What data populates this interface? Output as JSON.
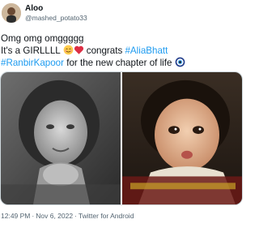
{
  "author": {
    "name": "Aloo",
    "handle": "@mashed_potato33"
  },
  "tweet": {
    "line1": "Omg omg omggggg",
    "line2_start": "It's a GIRLLLL",
    "line2_mid": " congrats ",
    "hashtag1": "#AliaBhatt",
    "hashtag2": "#RanbirKapoor",
    "line3_end": " for the new chapter of life"
  },
  "emojis": [
    "smiling-face-emoji",
    "red-heart-emoji",
    "nazar-amulet-emoji"
  ],
  "meta": {
    "time": "12:49 PM",
    "date": "Nov 6, 2022",
    "source": "Twitter for Android",
    "separator": "·"
  },
  "colors": {
    "link": "#1d9bf0",
    "secondary_text": "#536471"
  }
}
